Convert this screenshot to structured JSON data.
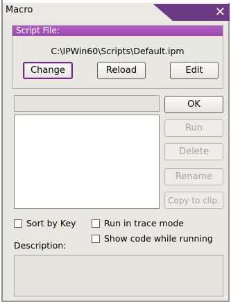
{
  "window": {
    "title": "Macro",
    "close_glyph": "✕"
  },
  "script_file": {
    "header": "Script File:",
    "path": "C:\\IPWin60\\Scripts\\Default.ipm",
    "buttons": {
      "change": "Change",
      "reload": "Reload",
      "edit": "Edit"
    }
  },
  "name_field": {
    "value": ""
  },
  "side_buttons": {
    "ok": "OK",
    "run": "Run",
    "delete": "Delete",
    "rename": "Rename",
    "copy": "Copy to clip."
  },
  "options": {
    "sort_by_key": "Sort by Key",
    "run_in_trace": "Run in trace mode",
    "show_code": "Show code while running"
  },
  "description": {
    "label": "Description:",
    "value": ""
  },
  "colors": {
    "accent": "#9c48b1",
    "title_tab": "#5a2a74"
  }
}
